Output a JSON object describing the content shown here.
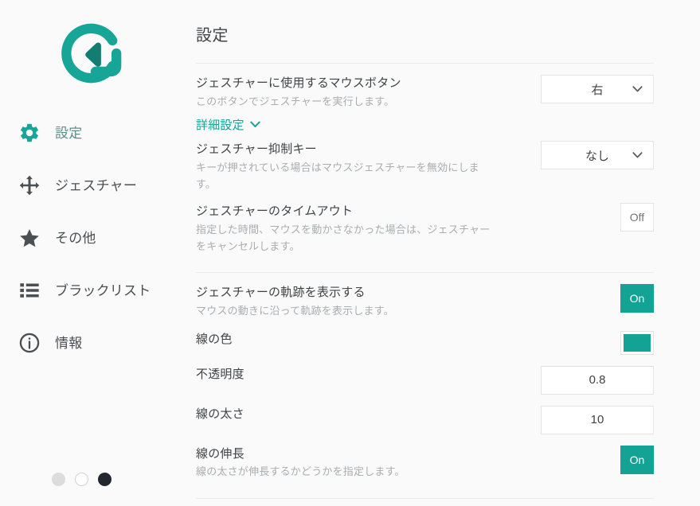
{
  "brand": {
    "accent": "#13a394",
    "logo_icon": "g-gesture-logo"
  },
  "sidebar": {
    "items": [
      {
        "label": "設定",
        "icon": "gear-icon",
        "active": true
      },
      {
        "label": "ジェスチャー",
        "icon": "move-arrows-icon",
        "active": false
      },
      {
        "label": "その他",
        "icon": "star-icon",
        "active": false
      },
      {
        "label": "ブラックリスト",
        "icon": "list-icon",
        "active": false
      },
      {
        "label": "情報",
        "icon": "info-icon",
        "active": false
      }
    ],
    "pager": {
      "dots": [
        "gray",
        "hollow",
        "dark"
      ]
    }
  },
  "main": {
    "title": "設定",
    "advanced_link": {
      "label": "詳細設定",
      "icon": "chevron-down-icon"
    },
    "rows": [
      {
        "title": "ジェスチャーに使用するマウスボタン",
        "desc": "このボタンでジェスチャーを実行します。",
        "control": "select",
        "value": "右"
      },
      {
        "title": "ジェスチャー抑制キー",
        "desc": "キーが押されている場合はマウスジェスチャーを無効にします。",
        "control": "select",
        "value": "なし"
      },
      {
        "title": "ジェスチャーのタイムアウト",
        "desc": "指定した時間、マウスを動かさなかった場合は、ジェスチャーをキャンセルします。",
        "control": "toggle",
        "value": "Off",
        "state": "off"
      },
      {
        "title": "ジェスチャーの軌跡を表示する",
        "desc": "マウスの動きに沿って軌跡を表示します。",
        "control": "toggle",
        "value": "On",
        "state": "on"
      },
      {
        "title": "線の色",
        "desc": "",
        "control": "color",
        "value": "#13a394"
      },
      {
        "title": "不透明度",
        "desc": "",
        "control": "text",
        "value": "0.8"
      },
      {
        "title": "線の太さ",
        "desc": "",
        "control": "text",
        "value": "10"
      },
      {
        "title": "線の伸長",
        "desc": "線の太さが伸長するかどうかを指定します。",
        "control": "toggle",
        "value": "On",
        "state": "on"
      }
    ]
  }
}
